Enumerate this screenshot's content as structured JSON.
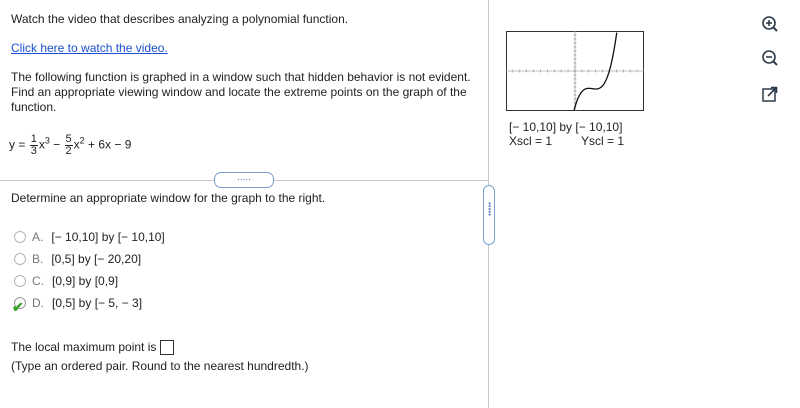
{
  "prompt": {
    "video_text": "Watch the video that describes analyzing a polynomial function.",
    "video_link": "Click here to watch the video."
  },
  "problem": {
    "statement": "The following function is graphed in a window such that hidden behavior is not evident. Find an appropriate viewing window and locate the extreme points on the graph of the function.",
    "eq_y": "y =",
    "term1_num": "1",
    "term1_den": "3",
    "term1_var": "x",
    "term1_exp": "3",
    "minus": "−",
    "term2_num": "5",
    "term2_den": "2",
    "term2_var": "x",
    "term2_exp": "2",
    "rest": "+ 6x − 9"
  },
  "expander_dots": ".....",
  "question": "Determine an appropriate window for the graph to the right.",
  "options": [
    {
      "letter": "A.",
      "text": "[− 10,10] by [− 10,10]",
      "selected": false
    },
    {
      "letter": "B.",
      "text": "[0,5] by [− 20,20]",
      "selected": false
    },
    {
      "letter": "C.",
      "text": "[0,9] by [0,9]",
      "selected": false
    },
    {
      "letter": "D.",
      "text": "[0,5] by [− 5, − 3]",
      "selected": true
    }
  ],
  "answer": {
    "prompt": "The local maximum point is",
    "note": "(Type an ordered pair. Round to the nearest hundredth.)"
  },
  "graph": {
    "window": "[− 10,10] by [− 10,10]",
    "xscl": "Xscl = 1",
    "yscl": "Yscl = 1"
  },
  "icons": [
    "zoom-in-icon",
    "zoom-out-icon",
    "open-external-icon"
  ]
}
